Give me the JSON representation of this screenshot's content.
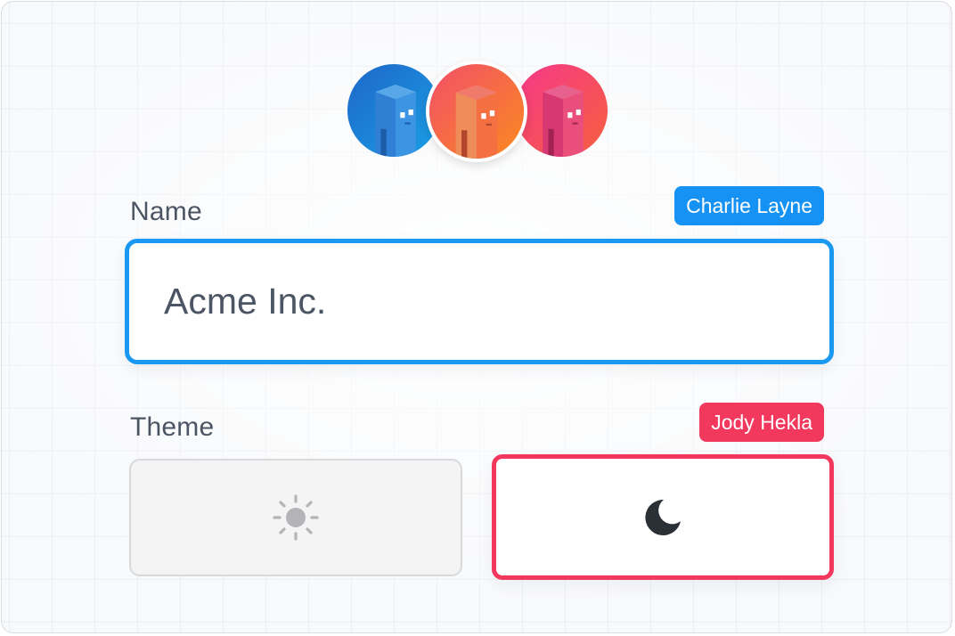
{
  "collaborators": [
    {
      "icon": "building-avatar-blue"
    },
    {
      "icon": "building-avatar-orange"
    },
    {
      "icon": "building-avatar-pink"
    }
  ],
  "form": {
    "name_label": "Name",
    "name_value": "Acme Inc.",
    "name_cursor_user": "Charlie Layne",
    "theme_label": "Theme",
    "theme_cursor_user": "Jody Hekla",
    "theme_options": [
      {
        "icon": "sun-icon",
        "selected": false
      },
      {
        "icon": "moon-icon",
        "selected": true
      }
    ]
  },
  "colors": {
    "charlie": "#1592f3",
    "jody": "#f2385c",
    "label": "#4b5563"
  }
}
